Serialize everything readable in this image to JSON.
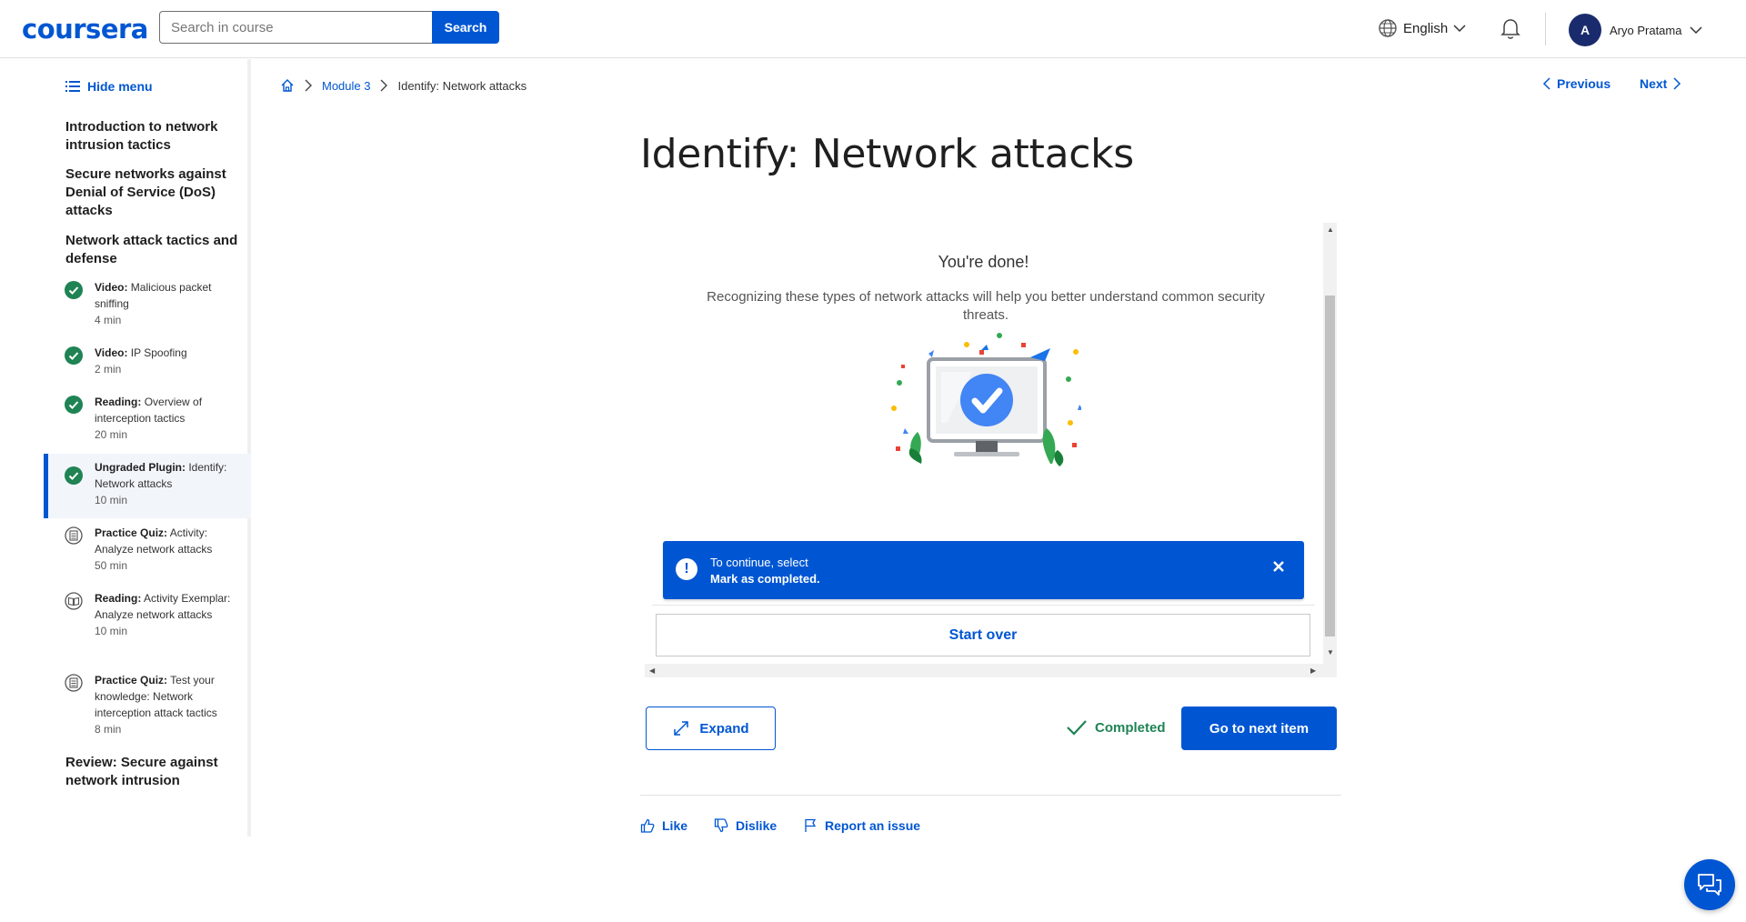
{
  "header": {
    "logo": "coursera",
    "search_placeholder": "Search in course",
    "search_button": "Search",
    "language": "English",
    "user_initial": "A",
    "user_name": "Aryo Pratama"
  },
  "sidebar": {
    "hide_menu": "Hide menu",
    "sections": [
      "Introduction to network intrusion tactics",
      "Secure networks against Denial of Service (DoS) attacks",
      "Network attack tactics and defense",
      "Review: Secure against network intrusion"
    ],
    "items": [
      {
        "type": "Video:",
        "title": "Malicious packet sniffing",
        "duration": "4 min",
        "status": "completed"
      },
      {
        "type": "Video:",
        "title": "IP Spoofing",
        "duration": "2 min",
        "status": "completed"
      },
      {
        "type": "Reading:",
        "title": "Overview of interception tactics",
        "duration": "20 min",
        "status": "completed"
      },
      {
        "type": "Ungraded Plugin:",
        "title": "Identify: Network attacks",
        "duration": "10 min",
        "status": "completed"
      },
      {
        "type": "Practice Quiz:",
        "title": "Activity: Analyze network attacks",
        "duration": "50 min",
        "status": "quiz"
      },
      {
        "type": "Reading:",
        "title": "Activity Exemplar: Analyze network attacks",
        "duration": "10 min",
        "status": "reading"
      },
      {
        "type": "Practice Quiz:",
        "title": "Test your knowledge: Network interception attack tactics",
        "duration": "8 min",
        "status": "quiz"
      }
    ]
  },
  "breadcrumb": {
    "module": "Module 3",
    "current": "Identify: Network attacks"
  },
  "nav": {
    "previous": "Previous",
    "next": "Next"
  },
  "main": {
    "title": "Identify: Network attacks",
    "done_title": "You're done!",
    "done_text": "Recognizing these types of network attacks will help you better understand common security threats.",
    "alert_line1": "To continue, select",
    "alert_line2": "Mark as completed.",
    "start_over": "Start over",
    "expand": "Expand",
    "completed": "Completed",
    "go_next": "Go to next item"
  },
  "feedback": {
    "like": "Like",
    "dislike": "Dislike",
    "report": "Report an issue"
  },
  "colors": {
    "accent": "#0056d2",
    "success": "#1f8354"
  }
}
